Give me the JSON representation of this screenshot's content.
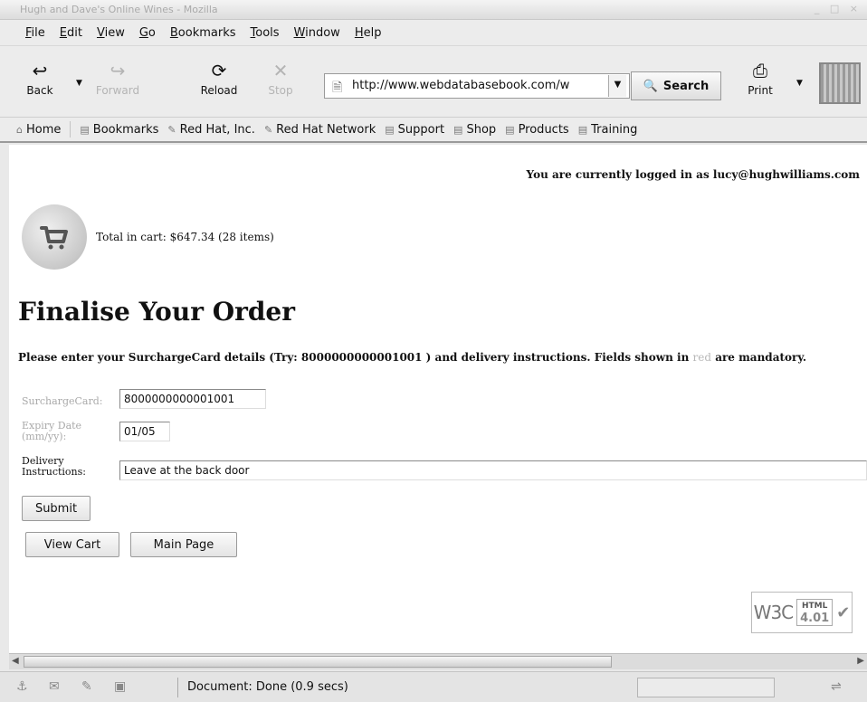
{
  "window": {
    "title": "Hugh and Dave's Online Wines - Mozilla"
  },
  "menu": [
    "File",
    "Edit",
    "View",
    "Go",
    "Bookmarks",
    "Tools",
    "Window",
    "Help"
  ],
  "toolbar": {
    "back": "Back",
    "forward": "Forward",
    "reload": "Reload",
    "stop": "Stop",
    "url": "http://www.webdatabasebook.com/w",
    "search": "Search",
    "print": "Print"
  },
  "bookmarks": [
    "Home",
    "Bookmarks",
    "Red Hat, Inc.",
    "Red Hat Network",
    "Support",
    "Shop",
    "Products",
    "Training"
  ],
  "page": {
    "logged_in": "You are currently logged in as lucy@hughwilliams.com",
    "cart_total": "Total in cart: $647.34 (28 items)",
    "heading": "Finalise Your Order",
    "instructions_pre": "Please enter your SurchargeCard details (Try: 8000000000001001 ) and delivery instructions. Fields shown in ",
    "instructions_red": "red",
    "instructions_post": " are mandatory.",
    "card_label": "SurchargeCard:",
    "card_value": "8000000000001001",
    "expiry_label": "Expiry Date (mm/yy):",
    "expiry_value": "01/05",
    "delivery_label": "Delivery Instructions:",
    "delivery_value": "Leave at the back door",
    "submit": "Submit",
    "view_cart": "View Cart",
    "main_page": "Main Page",
    "w3c_text": "W3C",
    "w3c_html": "HTML",
    "w3c_version": "4.01"
  },
  "status": {
    "text": "Document: Done (0.9 secs)"
  },
  "icons": {
    "cart": "shopping-cart-icon",
    "back": "back-arrow-icon",
    "forward": "forward-arrow-icon",
    "reload": "reload-icon",
    "stop": "stop-icon",
    "search": "search-icon",
    "print": "printer-icon",
    "bookmark": "bookmark-folder-icon"
  },
  "colors": {
    "mandatory_label": "#aaaaaa",
    "content_bg": "#ffffff",
    "chrome_bg": "#ececec"
  }
}
